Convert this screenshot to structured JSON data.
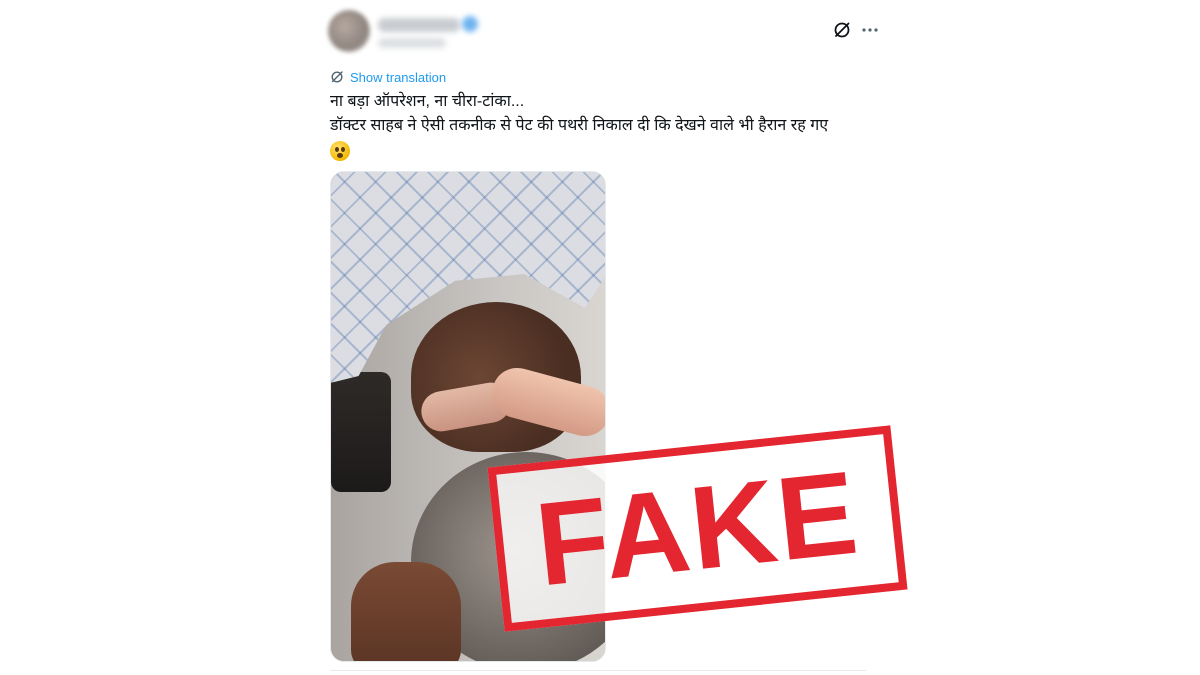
{
  "tweet": {
    "translate_label": "Show translation",
    "text_line_1": "ना बड़ा ऑपरेशन, ना चीरा-टांका...",
    "text_line_2": "डॉक्टर साहब ने ऐसी तकनीक से पेट की पथरी निकाल दी कि देखने वाले भी हैरान रह गए",
    "emoji_name": "astonished-face-emoji",
    "media_description_icon": "video-thumbnail"
  },
  "header": {
    "icons": [
      "grok-icon",
      "more-icon"
    ]
  },
  "stamp": {
    "label": "FAKE",
    "color": "#e3262f"
  },
  "colors": {
    "link": "#1d9bf0",
    "text": "#0f1419",
    "stamp": "#e3262f"
  }
}
